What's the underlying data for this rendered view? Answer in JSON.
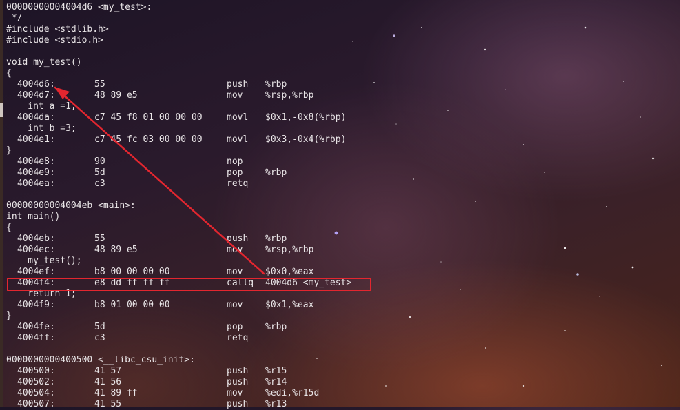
{
  "terminal": {
    "lines": [
      {
        "type": "src",
        "text": "00000000004004d6 <my_test>:"
      },
      {
        "type": "src",
        "text": " */"
      },
      {
        "type": "src",
        "text": "#include <stdlib.h>"
      },
      {
        "type": "src",
        "text": "#include <stdio.h>"
      },
      {
        "type": "src",
        "text": ""
      },
      {
        "type": "src",
        "text": "void my_test()"
      },
      {
        "type": "src",
        "text": "{"
      },
      {
        "type": "asm",
        "addr": "4004d6:",
        "bytes": "55",
        "mn": "push",
        "op": "%rbp"
      },
      {
        "type": "asm",
        "addr": "4004d7:",
        "bytes": "48 89 e5",
        "mn": "mov",
        "op": "%rsp,%rbp"
      },
      {
        "type": "src",
        "text": "    int a =1;"
      },
      {
        "type": "asm",
        "addr": "4004da:",
        "bytes": "c7 45 f8 01 00 00 00",
        "mn": "movl",
        "op": "$0x1,-0x8(%rbp)"
      },
      {
        "type": "src",
        "text": "    int b =3;"
      },
      {
        "type": "asm",
        "addr": "4004e1:",
        "bytes": "c7 45 fc 03 00 00 00",
        "mn": "movl",
        "op": "$0x3,-0x4(%rbp)"
      },
      {
        "type": "src",
        "text": "}"
      },
      {
        "type": "asm",
        "addr": "4004e8:",
        "bytes": "90",
        "mn": "nop",
        "op": ""
      },
      {
        "type": "asm",
        "addr": "4004e9:",
        "bytes": "5d",
        "mn": "pop",
        "op": "%rbp"
      },
      {
        "type": "asm",
        "addr": "4004ea:",
        "bytes": "c3",
        "mn": "retq",
        "op": ""
      },
      {
        "type": "src",
        "text": ""
      },
      {
        "type": "src",
        "text": "00000000004004eb <main>:"
      },
      {
        "type": "src",
        "text": "int main()"
      },
      {
        "type": "src",
        "text": "{"
      },
      {
        "type": "asm",
        "addr": "4004eb:",
        "bytes": "55",
        "mn": "push",
        "op": "%rbp"
      },
      {
        "type": "asm",
        "addr": "4004ec:",
        "bytes": "48 89 e5",
        "mn": "mov",
        "op": "%rsp,%rbp"
      },
      {
        "type": "src",
        "text": "    my_test();"
      },
      {
        "type": "asm",
        "addr": "4004ef:",
        "bytes": "b8 00 00 00 00",
        "mn": "mov",
        "op": "$0x0,%eax"
      },
      {
        "type": "asm",
        "addr": "4004f4:",
        "bytes": "e8 dd ff ff ff",
        "mn": "callq",
        "op": "4004d6 <my_test>"
      },
      {
        "type": "src",
        "text": "    return 1;"
      },
      {
        "type": "asm",
        "addr": "4004f9:",
        "bytes": "b8 01 00 00 00",
        "mn": "mov",
        "op": "$0x1,%eax"
      },
      {
        "type": "src",
        "text": "}"
      },
      {
        "type": "asm",
        "addr": "4004fe:",
        "bytes": "5d",
        "mn": "pop",
        "op": "%rbp"
      },
      {
        "type": "asm",
        "addr": "4004ff:",
        "bytes": "c3",
        "mn": "retq",
        "op": ""
      },
      {
        "type": "src",
        "text": ""
      },
      {
        "type": "src",
        "text": "0000000000400500 <__libc_csu_init>:"
      },
      {
        "type": "asm",
        "addr": "400500:",
        "bytes": "41 57",
        "mn": "push",
        "op": "%r15"
      },
      {
        "type": "asm",
        "addr": "400502:",
        "bytes": "41 56",
        "mn": "push",
        "op": "%r14"
      },
      {
        "type": "asm",
        "addr": "400504:",
        "bytes": "41 89 ff",
        "mn": "mov",
        "op": "%edi,%r15d"
      },
      {
        "type": "asm",
        "addr": "400507:",
        "bytes": "41 55",
        "mn": "push",
        "op": "%r13"
      }
    ]
  },
  "annotation": {
    "color": "#e3262f",
    "highlighted_address": "4004f4:",
    "arrow_target_address": "4004d6:"
  }
}
